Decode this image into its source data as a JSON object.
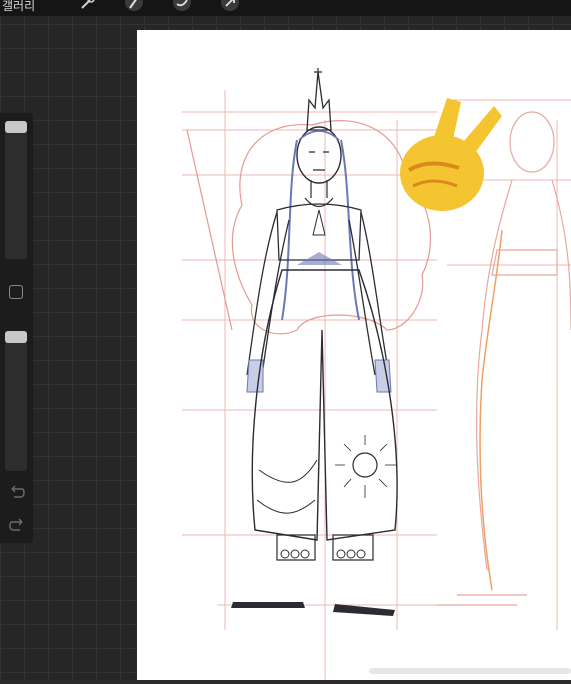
{
  "toolbar": {
    "gallery_label": "갤러리",
    "tools": [
      {
        "icon": "wrench-icon"
      },
      {
        "icon": "magic-wand-icon"
      },
      {
        "icon": "selection-icon"
      },
      {
        "icon": "transform-arrow-icon"
      }
    ]
  },
  "sidebar": {
    "brush_size_level": 0.05,
    "opacity_level": 0.05,
    "modify_button_icon": "square-modify-icon",
    "undo_icon": "undo-arrow-icon",
    "redo_icon": "redo-arrow-icon"
  },
  "canvas": {
    "background": "#ffffff",
    "overlay_emoji": "✌️"
  },
  "colors": {
    "app_bg": "#262626",
    "sketch_red": "#e08a84",
    "sketch_blue": "#6a78b8",
    "ink": "#2b2b33",
    "emoji_yellow": "#f5c531"
  }
}
